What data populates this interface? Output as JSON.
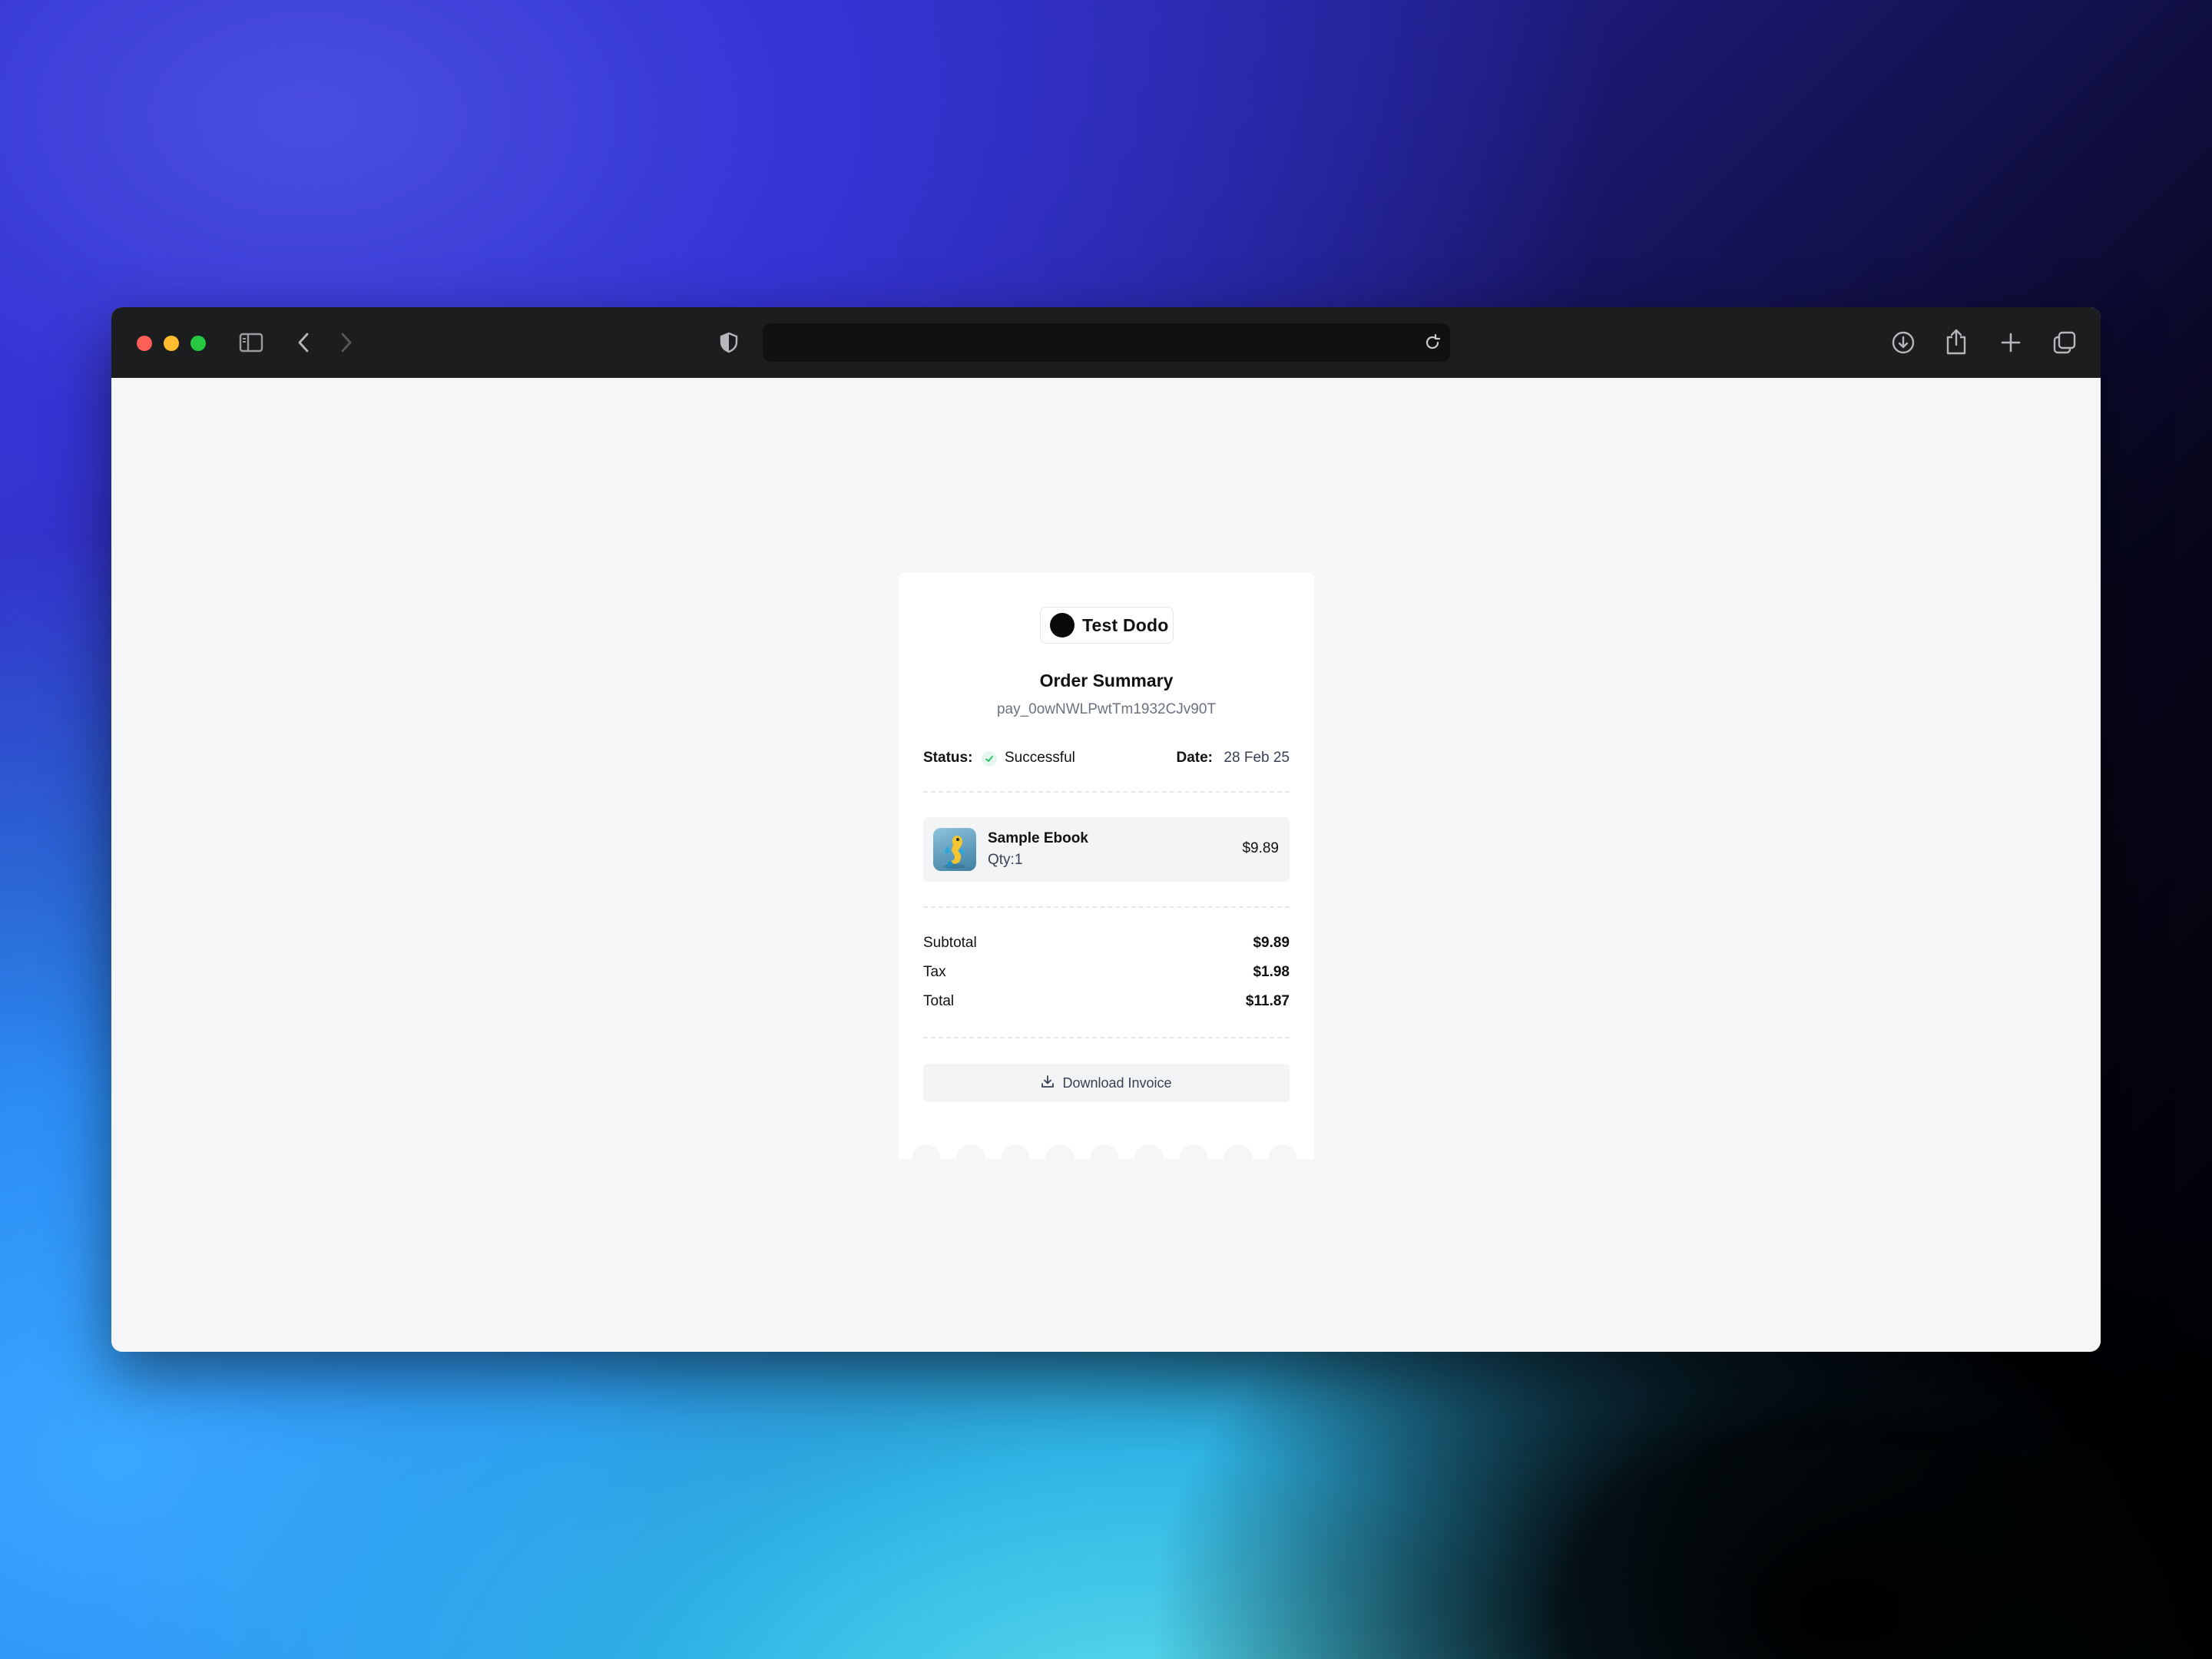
{
  "browser": {
    "address_value": ""
  },
  "card": {
    "brand_name": "Test Dodo",
    "title": "Order Summary",
    "payment_id": "pay_0owNWLPwtTm1932CJv90T",
    "status_label": "Status:",
    "status_value": "Successful",
    "date_label": "Date:",
    "date_value": "28 Feb 25",
    "item": {
      "name": "Sample Ebook",
      "qty": "Qty:1",
      "price": "$9.89"
    },
    "totals": [
      {
        "label": "Subtotal",
        "value": "$9.89"
      },
      {
        "label": "Tax",
        "value": "$1.98"
      },
      {
        "label": "Total",
        "value": "$11.87"
      }
    ],
    "download_label": "Download Invoice"
  },
  "colors": {
    "success": "#22c55e",
    "card_bg": "#ffffff",
    "page_bg": "#f5f6f8"
  },
  "icons": [
    "sidebar-icon",
    "back-icon",
    "forward-icon",
    "shield-icon",
    "reload-icon",
    "download-icon",
    "share-icon",
    "plus-icon",
    "tabs-icon",
    "check-icon"
  ]
}
